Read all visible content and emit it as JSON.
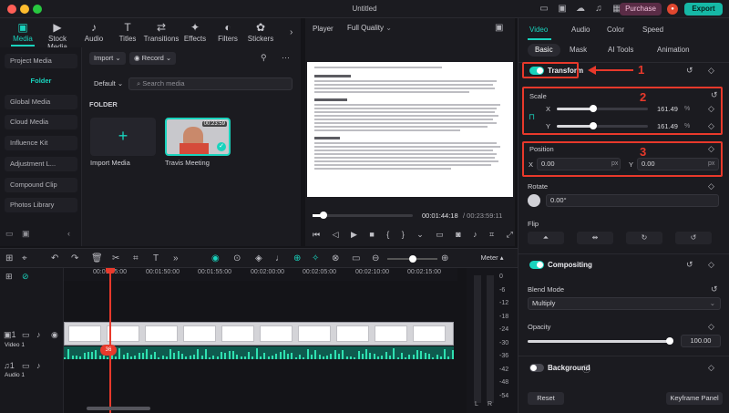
{
  "window": {
    "title": "Untitled"
  },
  "header": {
    "purchase_label": "Purchase",
    "export_label": "Export"
  },
  "media_tabs": [
    {
      "label": "Media",
      "icon": "folder-icon",
      "glyph": "▣"
    },
    {
      "label": "Stock Media",
      "icon": "film-icon",
      "glyph": "▶"
    },
    {
      "label": "Audio",
      "icon": "music-note-icon",
      "glyph": "♪"
    },
    {
      "label": "Titles",
      "icon": "text-icon",
      "glyph": "T"
    },
    {
      "label": "Transitions",
      "icon": "transitions-icon",
      "glyph": "⇄"
    },
    {
      "label": "Effects",
      "icon": "effects-icon",
      "glyph": "✦"
    },
    {
      "label": "Filters",
      "icon": "filters-icon",
      "glyph": "◐"
    },
    {
      "label": "Stickers",
      "icon": "stickers-icon",
      "glyph": "✿"
    }
  ],
  "left_nav": [
    "Project Media",
    "Folder",
    "Global Media",
    "Cloud Media",
    "Influence Kit",
    "Adjustment L...",
    "Compound Clip",
    "Photos Library"
  ],
  "media_area": {
    "import_label": "Import",
    "record_label": "Record",
    "sort_label": "Default",
    "search_placeholder": "Search media",
    "folder_heading": "FOLDER",
    "import_media_caption": "Import Media",
    "clip_caption": "Travis Meeting",
    "clip_duration": "00:23:59"
  },
  "player": {
    "label": "Player",
    "quality": "Full Quality",
    "current_time": "00:01:44:18",
    "total_time": "00:23:59:11",
    "scrub_progress": 0.11
  },
  "right_panel": {
    "tabs": [
      "Video",
      "Audio",
      "Color",
      "Speed"
    ],
    "subtabs": [
      "Basic",
      "Mask",
      "AI Tools",
      "Animation"
    ],
    "transform_label": "Transform",
    "scale_label": "Scale",
    "scale_x_label": "X",
    "scale_y_label": "Y",
    "scale_x": "161.49",
    "scale_y": "161.49",
    "percent_unit": "%",
    "position_label": "Position",
    "pos_x_label": "X",
    "pos_y_label": "Y",
    "pos_x": "0.00",
    "pos_y": "0.00",
    "px_unit": "px",
    "rotate_label": "Rotate",
    "rotate_value": "0.00°",
    "flip_label": "Flip",
    "compositing_label": "Compositing",
    "blend_mode_label": "Blend Mode",
    "blend_mode_value": "Multiply",
    "opacity_label": "Opacity",
    "opacity_value": "100.00",
    "background_label": "Background",
    "reset_label": "Reset",
    "keyframe_panel_label": "Keyframe Panel"
  },
  "annotations": {
    "callout_1": "1",
    "callout_2": "2",
    "callout_3": "3"
  },
  "timeline": {
    "ruler_ticks": [
      "00:01:45:00",
      "00:01:50:00",
      "00:01:55:00",
      "00:02:00:00",
      "00:02:05:00",
      "00:02:10:00",
      "00:02:15:00"
    ],
    "video_track_label": "Video 1",
    "audio_track_label": "Audio 1",
    "playhead_marker": "36"
  },
  "meter": {
    "label": "Meter",
    "db_ticks": [
      "0",
      "-6",
      "-12",
      "-18",
      "-24",
      "-30",
      "-36",
      "-42",
      "-48",
      "-54"
    ],
    "left_label": "L",
    "right_label": "R"
  },
  "colors": {
    "accent": "#19d3bd",
    "annotation_red": "#e8392b",
    "export": "#16b8a6"
  }
}
